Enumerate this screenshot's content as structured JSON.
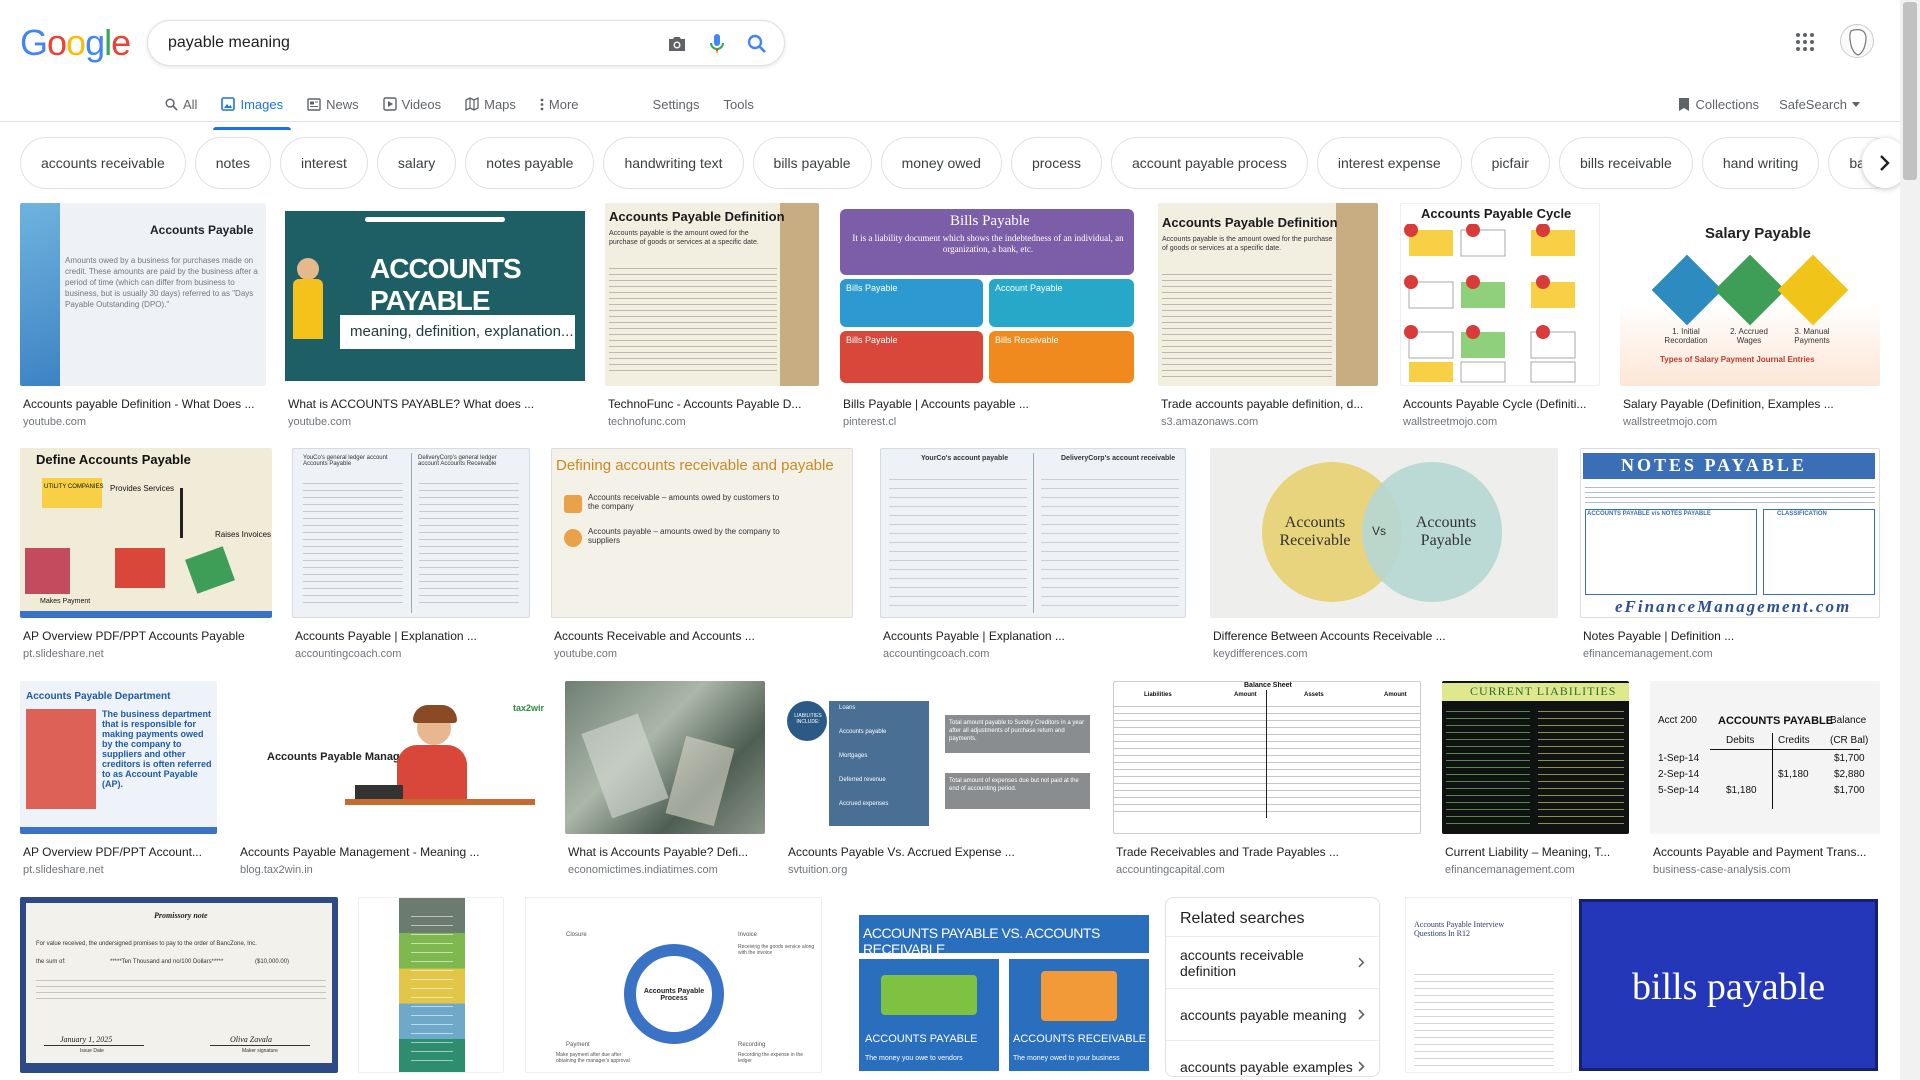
{
  "logo": {
    "text": "Google"
  },
  "search": {
    "query": "payable meaning"
  },
  "icons": {
    "camera": "camera-icon",
    "mic": "microphone-icon",
    "search": "search-icon",
    "apps": "apps-grid-icon"
  },
  "tabs": [
    {
      "label": "All",
      "icon": "search-icon"
    },
    {
      "label": "Images",
      "icon": "image-icon"
    },
    {
      "label": "News",
      "icon": "news-icon"
    },
    {
      "label": "Videos",
      "icon": "video-icon"
    },
    {
      "label": "Maps",
      "icon": "map-icon"
    },
    {
      "label": "More",
      "icon": "more-vert-icon"
    }
  ],
  "tools": {
    "settings": "Settings",
    "tools": "Tools",
    "collections": "Collections",
    "safesearch": "SafeSearch"
  },
  "chips": [
    "accounts receivable",
    "notes",
    "interest",
    "salary",
    "notes payable",
    "handwriting text",
    "bills payable",
    "money owed",
    "process",
    "account payable process",
    "interest expense",
    "picfair",
    "bills receivable",
    "hand writing",
    "bala"
  ],
  "row1": [
    {
      "title": "Accounts payable Definition - What Does ...",
      "source": "youtube.com",
      "thumb_heading": "Accounts Payable",
      "thumb_text": "Amounts owed by a business for purchases made on credit. These amounts are paid by the business after a period of time (which can differ from business to business, but is usually 30 days) referred to as \"Days Payable Outstanding (DPO).\""
    },
    {
      "title": "What is ACCOUNTS PAYABLE? What does ...",
      "source": "youtube.com",
      "thumb_heading": "ACCOUNTS PAYABLE",
      "thumb_text": "meaning, definition, explanation..."
    },
    {
      "title": "TechnoFunc - Accounts Payable D...",
      "source": "technofunc.com",
      "thumb_heading": "Accounts Payable Definition",
      "thumb_text": "Accounts payable is the amount owed for the purchase of goods or services at a specific date."
    },
    {
      "title": "Bills Payable | Accounts payable ...",
      "source": "pinterest.cl",
      "thumb_heading": "Bills Payable",
      "thumb_text": "It is a liability document which shows the indebtedness of an individual, an organization, a bank, etc.",
      "thumb_boxes": [
        "Bills Payable",
        "Account Payable",
        "Bills Payable",
        "Bills Receivable"
      ]
    },
    {
      "title": "Trade accounts payable definition, d...",
      "source": "s3.amazonaws.com",
      "thumb_heading": "Accounts Payable Definition",
      "thumb_text": "Accounts payable is the amount owed for the purchase of goods or services at a specific date."
    },
    {
      "title": "Accounts Payable Cycle (Definiti...",
      "source": "wallstreetmojo.com",
      "thumb_heading": "Accounts Payable Cycle"
    },
    {
      "title": "Salary Payable (Definition, Examples ...",
      "source": "wallstreetmojo.com",
      "thumb_heading": "Salary Payable",
      "thumb_text": "Types of Salary Payment Journal Entries",
      "thumb_labels": [
        "1. Initial Recordation",
        "2. Accrued Wages",
        "3. Manual Payments"
      ]
    }
  ],
  "row2": [
    {
      "title": "AP Overview PDF/PPT Accounts Payable",
      "source": "pt.slideshare.net",
      "thumb_heading": "Define Accounts Payable",
      "thumb_labels": [
        "UTILITY COMPANIES",
        "Provides Services",
        "Raises Invoices",
        "Makes Payment"
      ]
    },
    {
      "title": "Accounts Payable | Explanation ...",
      "source": "accountingcoach.com",
      "thumb_labels": [
        "YouCo's general ledger account Accounts Payable",
        "DeliveryCorp's general ledger account Accounts Receivable"
      ]
    },
    {
      "title": "Accounts Receivable and Accounts ...",
      "source": "youtube.com",
      "thumb_heading": "Defining accounts receivable and payable",
      "thumb_labels": [
        "Accounts receivable – amounts owed by customers to the company",
        "Accounts payable – amounts owed by the company to suppliers"
      ]
    },
    {
      "title": "Accounts Payable | Explanation ...",
      "source": "accountingcoach.com",
      "thumb_labels": [
        "YourCo's account payable",
        "DeliveryCorp's account receivable"
      ]
    },
    {
      "title": "Difference Between Accounts Receivable ...",
      "source": "keydifferences.com",
      "thumb_labels": [
        "Accounts Receivable",
        "Vs",
        "Accounts Payable"
      ]
    },
    {
      "title": "Notes Payable | Definition ...",
      "source": "efinancemanagement.com",
      "thumb_heading": "NOTES PAYABLE",
      "thumb_text": "eFinanceManagement.com",
      "thumb_labels": [
        "ACCOUNTS PAYABLE v/s NOTES PAYABLE",
        "CLASSIFICATION"
      ]
    }
  ],
  "row3": [
    {
      "title": "AP Overview PDF/PPT Account...",
      "source": "pt.slideshare.net",
      "thumb_heading": "Accounts Payable Department",
      "thumb_text": "The business department that is responsible for making payments owed by the company to suppliers and other creditors is often referred to as Account Payable (AP)."
    },
    {
      "title": "Accounts Payable Management - Meaning ...",
      "source": "blog.tax2win.in",
      "thumb_heading": "Accounts Payable Management",
      "thumb_text": "tax2win"
    },
    {
      "title": "What is Accounts Payable? Defi...",
      "source": "economictimes.indiatimes.com"
    },
    {
      "title": "Accounts Payable Vs. Accrued Expense ...",
      "source": "svtuition.org",
      "thumb_labels": [
        "LIABILITIES INCLUDE:",
        "Loans",
        "Accounts payable",
        "Mortgages",
        "Deferred revenue",
        "Accrued expenses",
        "Total amount payable to Sundry Creditors in a year after all adjustments of purchase return and payments.",
        "Total amount of expenses due but not paid at the end of accounting period."
      ]
    },
    {
      "title": "Trade Receivables and Trade Payables ...",
      "source": "accountingcapital.com",
      "thumb_heading": "Balance Sheet",
      "thumb_labels": [
        "Liabilities",
        "Amount",
        "Assets",
        "Amount"
      ]
    },
    {
      "title": "Current Liability – Meaning, T...",
      "source": "efinancemanagement.com",
      "thumb_heading": "CURRENT LIABILITIES"
    },
    {
      "title": "Accounts Payable and Payment Trans...",
      "source": "business-case-analysis.com",
      "thumb_heading": "ACCOUNTS PAYABLE",
      "thumb_labels": [
        "Acct 200",
        "Balance",
        "Debits",
        "Credits",
        "(CR Bal)",
        "1-Sep-14",
        "2-Sep-14",
        "5-Sep-14",
        "$1,180",
        "$1,180",
        "$1,700",
        "$2,880",
        "$1,700"
      ]
    }
  ],
  "row4": [
    {
      "thumb_heading": "Promissory note",
      "thumb_text": "For value received, the undersigned promises to pay to the order of BancZone, Inc.",
      "thumb_labels": [
        "the sum of:",
        "*****Ten Thousand and no/100 Dollars*****",
        "($10,000.00)",
        "January 1, 2025",
        "Issue Date",
        "Oliva Zavala",
        "Maker signature"
      ]
    },
    {},
    {
      "thumb_heading": "Accounts Payable Process",
      "thumb_labels": [
        "Closure",
        "Invoice",
        "Receiving the goods service along with the invoice",
        "Payment",
        "Recording",
        "Make payment after due after obtaining the manager's approval",
        "Recording the expense in the ledger"
      ]
    },
    {
      "thumb_heading": "ACCOUNTS PAYABLE VS. ACCOUNTS RECEIVABLE",
      "thumb_labels": [
        "ACCOUNTS PAYABLE",
        "ACCOUNTS RECEIVABLE",
        "The money you owe to vendors",
        "The money owed to your business"
      ]
    },
    {
      "thumb_heading": "Accounts Payable Interview Questions In R12"
    },
    {
      "thumb_heading": "bills payable"
    }
  ],
  "related": {
    "title": "Related searches",
    "items": [
      "accounts receivable definition",
      "accounts payable meaning",
      "accounts payable examples"
    ]
  },
  "colors": {
    "accent": "#1a73e8",
    "google_blue": "#4285f4",
    "google_red": "#ea4335",
    "google_yellow": "#fbbc05",
    "google_green": "#34a853"
  }
}
